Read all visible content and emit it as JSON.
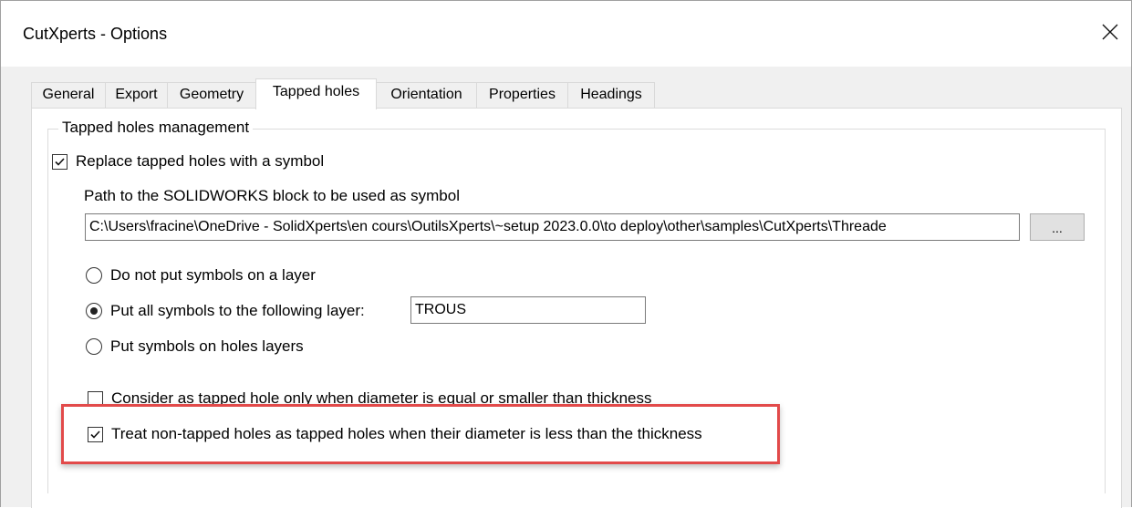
{
  "window": {
    "title": "CutXperts - Options",
    "close_glyph": "✕"
  },
  "tabs": [
    {
      "label": "General",
      "active": false
    },
    {
      "label": "Export",
      "active": false
    },
    {
      "label": "Geometry",
      "active": false
    },
    {
      "label": "Tapped holes",
      "active": true
    },
    {
      "label": "Orientation",
      "active": false
    },
    {
      "label": "Properties",
      "active": false
    },
    {
      "label": "Headings",
      "active": false
    }
  ],
  "tapped_holes": {
    "group_title": "Tapped holes management",
    "replace_checkbox": {
      "label": "Replace tapped holes with a symbol",
      "checked": true
    },
    "path_label": "Path to the SOLIDWORKS block to be used as symbol",
    "path_value": "C:\\Users\\fracine\\OneDrive - SolidXperts\\en cours\\OutilsXperts\\~setup 2023.0.0\\to deploy\\other\\samples\\CutXperts\\Threade",
    "browse_label": "...",
    "layer_options": [
      {
        "label": "Do not put symbols on a layer",
        "selected": false
      },
      {
        "label": "Put all symbols to the following layer:",
        "selected": true
      },
      {
        "label": "Put symbols on holes layers",
        "selected": false
      }
    ],
    "layer_name": "TROUS",
    "consider_checkbox": {
      "label": "Consider as tapped hole only when diameter is equal or smaller than thickness",
      "checked": false
    },
    "treat_checkbox": {
      "label": "Treat non-tapped holes as tapped holes when their diameter is less than the thickness",
      "checked": true
    }
  },
  "colors": {
    "highlight": "#e24a4a",
    "dialog_bg": "#f0f0f0",
    "panel_bg": "#ffffff"
  }
}
